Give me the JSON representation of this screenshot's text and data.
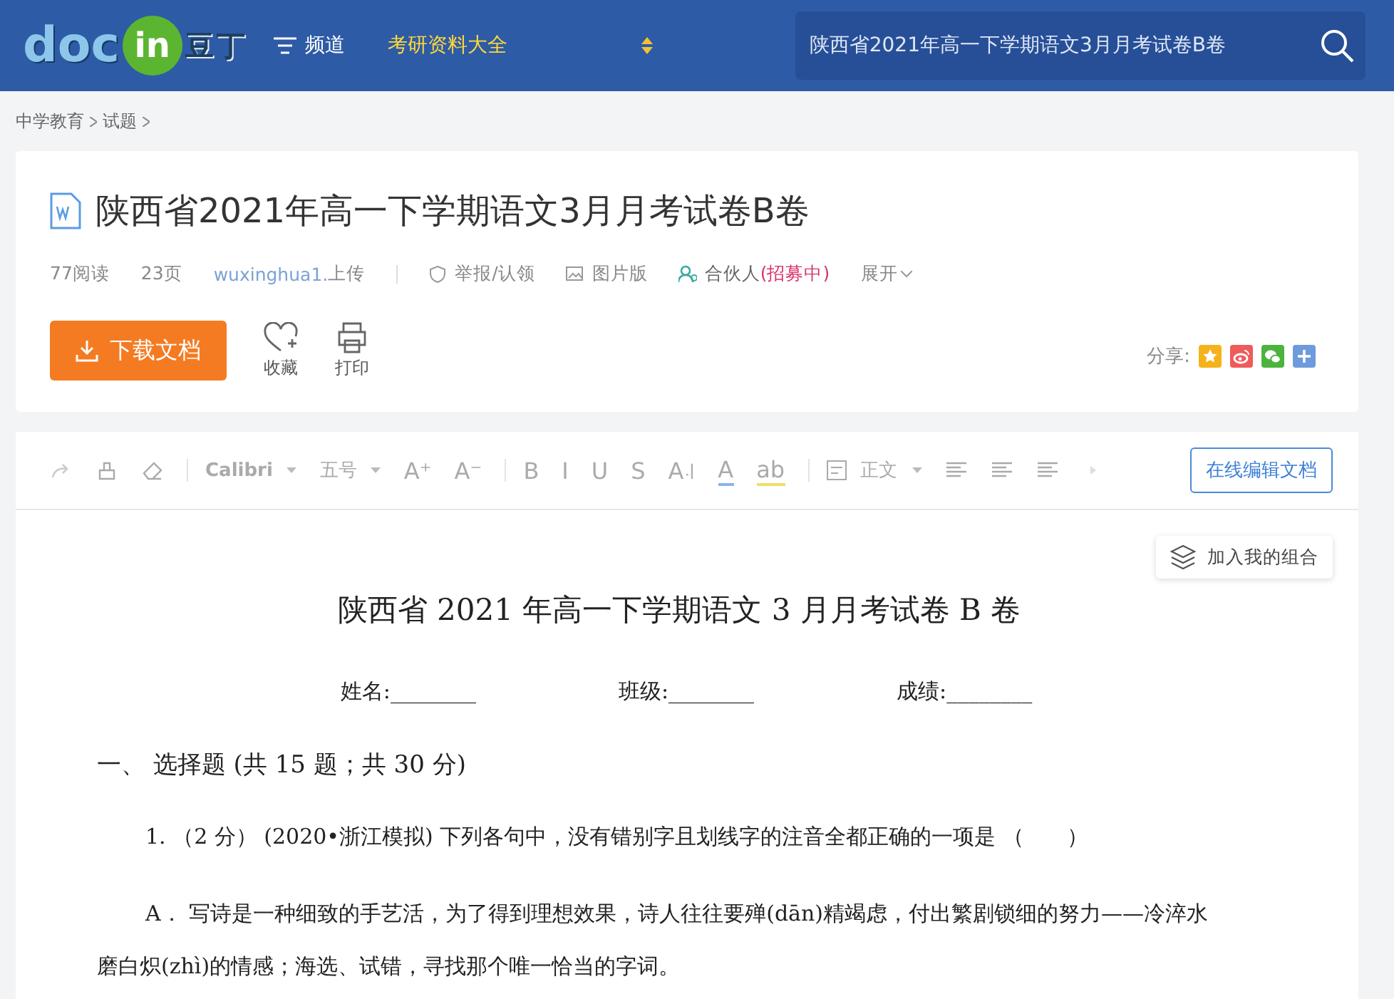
{
  "header": {
    "logo": {
      "left": "doc",
      "badge": "in",
      "right": "豆丁"
    },
    "channel_menu": {
      "label": "频道"
    },
    "promo_link": "考研资料大全",
    "search": {
      "value": "陕西省2021年高一下学期语文3月月考试卷B卷"
    }
  },
  "breadcrumb": [
    "中学教育",
    "试题"
  ],
  "document": {
    "title": "陕西省2021年高一下学期语文3月月考试卷B卷",
    "meta": [
      {
        "kind": "text",
        "text": "77阅读"
      },
      {
        "kind": "text",
        "text": "23页"
      },
      {
        "kind": "uploader",
        "user": "wuxinghua1.",
        "text": "上传"
      },
      {
        "kind": "report",
        "text": "举报/认领"
      },
      {
        "kind": "image",
        "text": "图片版"
      },
      {
        "kind": "partner",
        "text": "合伙人",
        "highlight": "(招募中)"
      },
      {
        "kind": "expand",
        "text": "展开"
      }
    ],
    "download_button": "下载文档",
    "actions": [
      {
        "kind": "favorite",
        "label": "收藏"
      },
      {
        "kind": "print",
        "label": "打印"
      }
    ],
    "share": {
      "label": "分享:",
      "targets": [
        {
          "kind": "star"
        },
        {
          "kind": "weibo"
        },
        {
          "kind": "wechat"
        },
        {
          "kind": "more"
        }
      ]
    }
  },
  "editor": {
    "toolbar": [
      {
        "kind": "redo"
      },
      {
        "kind": "painter"
      },
      {
        "kind": "eraser"
      },
      {
        "kind": "sep"
      },
      {
        "kind": "dropdown",
        "text": "Calibri"
      },
      {
        "kind": "dropdown",
        "text": "五号"
      },
      {
        "kind": "glyph",
        "text": "A⁺"
      },
      {
        "kind": "glyph",
        "text": "A⁻"
      },
      {
        "kind": "sep"
      },
      {
        "kind": "glyph",
        "text": "B"
      },
      {
        "kind": "glyph",
        "text": "I"
      },
      {
        "kind": "glyph",
        "text": "U"
      },
      {
        "kind": "glyph",
        "text": "S"
      },
      {
        "kind": "glyph",
        "text": "A꜋"
      },
      {
        "kind": "color",
        "text": "A"
      },
      {
        "kind": "highlight",
        "text": "ab"
      },
      {
        "kind": "sep"
      },
      {
        "kind": "style",
        "text": "正文"
      },
      {
        "kind": "align"
      },
      {
        "kind": "align"
      },
      {
        "kind": "align"
      },
      {
        "kind": "more"
      }
    ],
    "edit_button": "在线编辑文档",
    "add_button": "加入我的组合",
    "page": {
      "title": "陕西省 2021 年高一下学期语文 3 月月考试卷 B 卷",
      "fields": [
        "姓名:________",
        "班级:________",
        "成绩:________"
      ],
      "section": "一、  选择题 (共 15 题；共 30 分)",
      "question": "1. （2 分） (2020•浙江模拟) 下列各句中，没有错别字且划线字的注音全都正确的一项是 （　　）",
      "option": "A． 写诗是一种细致的手艺活，为了得到理想效果，诗人往往要殚(dān)精竭虑，付出繁剧锁细的努力——冷淬水磨白炽(zhì)的情感；海选、试错，寻找那个唯一恰当的字词。"
    }
  }
}
